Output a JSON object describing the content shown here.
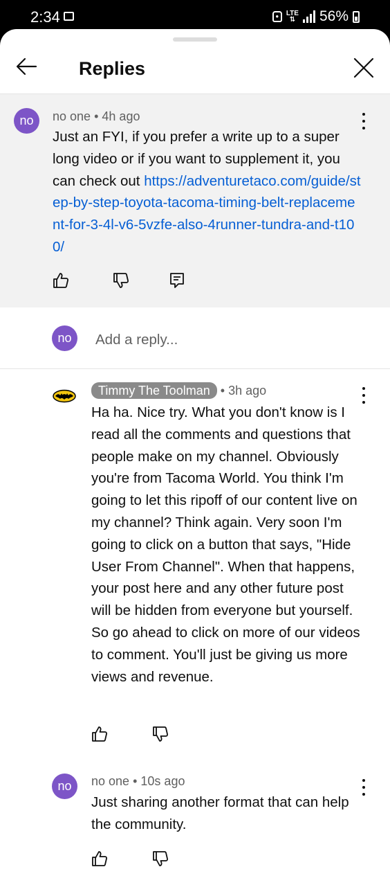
{
  "status_bar": {
    "time": "2:34",
    "network": "LTE",
    "battery": "56%"
  },
  "header": {
    "title": "Replies"
  },
  "top_comment": {
    "avatar": "no",
    "author": "no one",
    "separator": "•",
    "age": "4h ago",
    "text_before_link": "Just an FYI, if you prefer a write up to a super long video or if you want to supplement it, you can check out ",
    "link": "https://adventuretaco.com/guide/step-by-step-toyota-tacoma-timing-belt-replacement-for-3-4l-v6-5vzfe-also-4runner-tundra-and-t100/"
  },
  "reply_input": {
    "avatar": "no",
    "placeholder": "Add a reply..."
  },
  "replies": [
    {
      "author": "Timmy The Toolman",
      "separator": "•",
      "age": "3h ago",
      "text": "Ha ha.  Nice try.  What you don't know is I read all the comments and questions that people make on my channel.  Obviously you're from Tacoma World.  You think I'm going to let this ripoff of our content live on my channel?  Think again.  Very soon I'm going to click on a button that says, \"Hide User From Channel\".  When that happens, your post here and any other future post will be hidden from everyone but yourself.  So go ahead to click on more of our videos to comment.  You'll just be giving us more views and revenue."
    },
    {
      "avatar": "no",
      "author": "no one",
      "separator": "•",
      "age": "10s ago",
      "text": "Just sharing another format that can help the community."
    }
  ],
  "colors": {
    "avatar": "#7d55c7",
    "link": "#065fd4",
    "highlight_bg": "#f2f2f2",
    "channel_chip": "#8a8a8a"
  },
  "icons": [
    "back-arrow-icon",
    "close-icon",
    "more-vert-icon",
    "like-icon",
    "dislike-icon",
    "reply-icon",
    "batman-logo-icon"
  ]
}
